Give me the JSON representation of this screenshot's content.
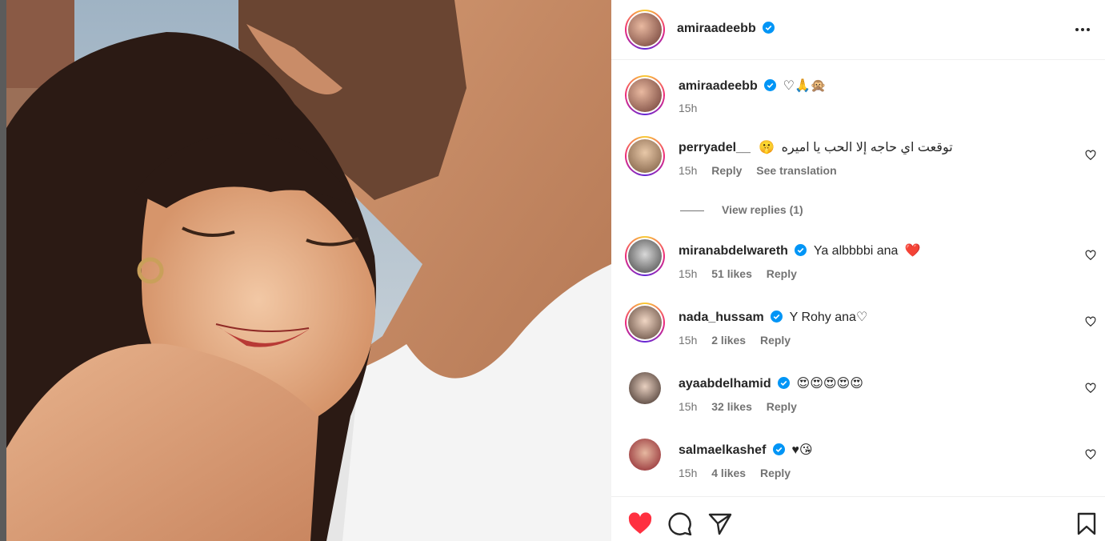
{
  "post": {
    "author": "amiraadeebb",
    "caption_emojis": "♡🙏🙊",
    "time": "15h"
  },
  "comments": [
    {
      "username": "perryadel__",
      "text": "توقعت اي حاجه إلا الحب يا اميره",
      "emoji": "🤫",
      "time": "15h",
      "reply_label": "Reply",
      "translate_label": "See translation",
      "view_replies": "View replies (1)"
    },
    {
      "username": "miranabdelwareth",
      "text": "Ya albbbbi ana",
      "emoji": "❤️",
      "time": "15h",
      "likes": "51 likes",
      "reply_label": "Reply"
    },
    {
      "username": "nada_hussam",
      "text": "Y Rohy ana♡",
      "time": "15h",
      "likes": "2 likes",
      "reply_label": "Reply"
    },
    {
      "username": "ayaabdelhamid",
      "text": "😍😍😍😍😍",
      "time": "15h",
      "likes": "32 likes",
      "reply_label": "Reply"
    },
    {
      "username": "salmaelkashef",
      "text": "♥😘",
      "time": "15h",
      "likes": "4 likes",
      "reply_label": "Reply"
    }
  ],
  "icons": {
    "verified": "verified-badge-icon",
    "more": "more-options-icon",
    "like": "heart-icon",
    "comment": "comment-icon",
    "share": "share-icon",
    "save": "bookmark-icon"
  },
  "colors": {
    "verified_blue": "#0095f6",
    "liked_red": "#ff3040",
    "muted_text": "#737373"
  }
}
